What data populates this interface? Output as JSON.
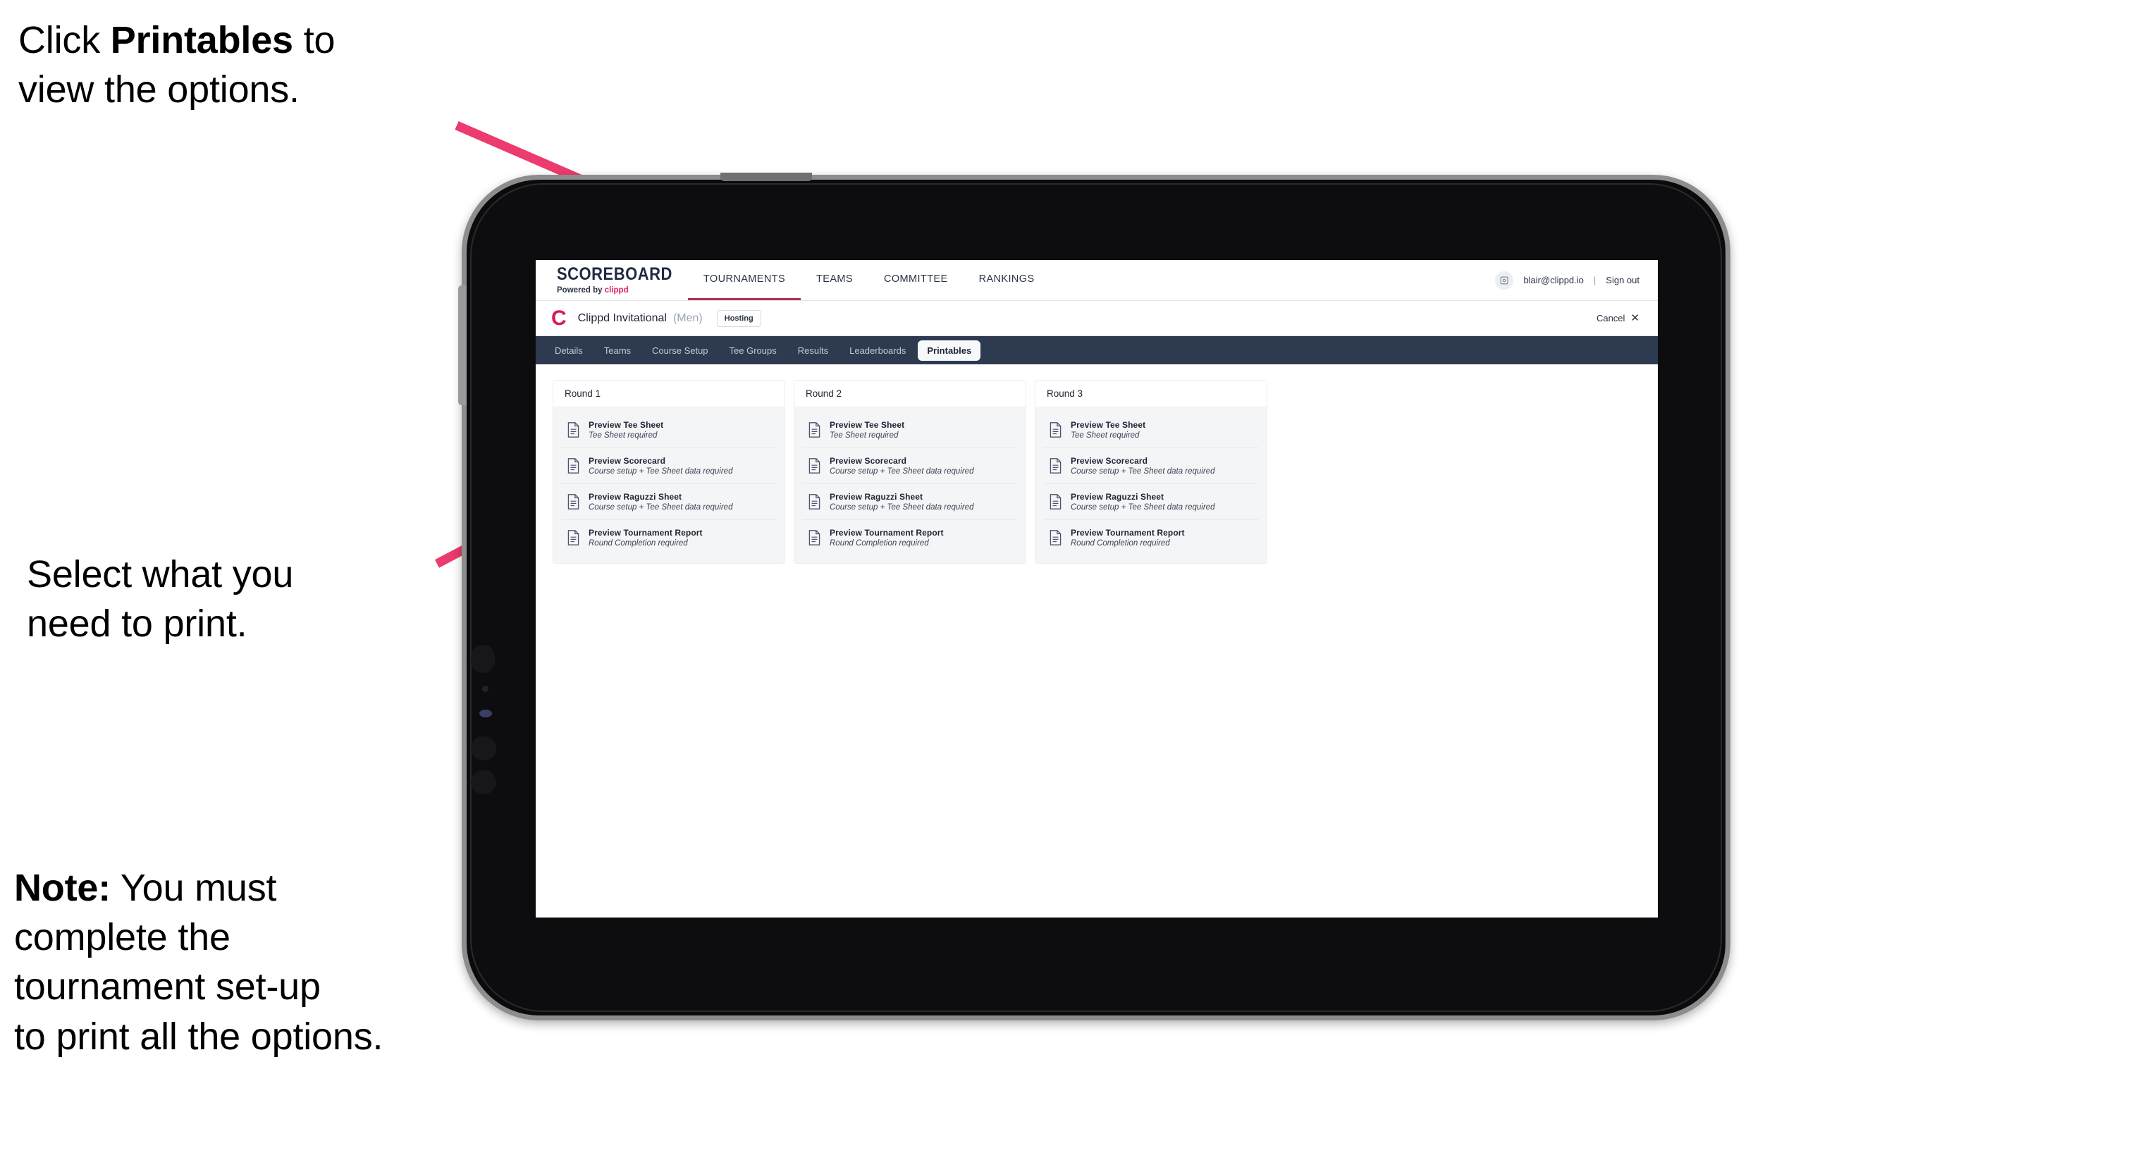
{
  "annotations": {
    "callout_1": {
      "prefix": "Click ",
      "bold": "Printables",
      "suffix": " to\nview the options."
    },
    "callout_2": {
      "text": "Select what you\n need to print."
    },
    "callout_3": {
      "bold": "Note:",
      "text": " You must\ncomplete the\ntournament set-up\nto print all the options."
    },
    "arrow_color": "#ec3b6e"
  },
  "app": {
    "brand": {
      "title": "SCOREBOARD",
      "powered_prefix": "Powered by ",
      "powered_brand": "clippd"
    },
    "main_nav": [
      {
        "label": "TOURNAMENTS",
        "active": true
      },
      {
        "label": "TEAMS",
        "active": false
      },
      {
        "label": "COMMITTEE",
        "active": false
      },
      {
        "label": "RANKINGS",
        "active": false
      }
    ],
    "account": {
      "avatar_glyph": "⛶",
      "email": "blair@clippd.io",
      "divider": "|",
      "sign_out": "Sign out"
    },
    "tournament": {
      "logo_letter": "C",
      "name": "Clippd Invitational",
      "gender": "(Men)",
      "status_badge": "Hosting",
      "cancel_label": "Cancel",
      "cancel_icon": "✕"
    },
    "tabs": [
      {
        "label": "Details",
        "active": false
      },
      {
        "label": "Teams",
        "active": false
      },
      {
        "label": "Course Setup",
        "active": false
      },
      {
        "label": "Tee Groups",
        "active": false
      },
      {
        "label": "Results",
        "active": false
      },
      {
        "label": "Leaderboards",
        "active": false
      },
      {
        "label": "Printables",
        "active": true
      }
    ],
    "rounds": [
      {
        "title": "Round 1",
        "items": [
          {
            "title": "Preview Tee Sheet",
            "subtitle": "Tee Sheet required"
          },
          {
            "title": "Preview Scorecard",
            "subtitle": "Course setup + Tee Sheet data required"
          },
          {
            "title": "Preview Raguzzi Sheet",
            "subtitle": "Course setup + Tee Sheet data required"
          },
          {
            "title": "Preview Tournament Report",
            "subtitle": "Round Completion required"
          }
        ]
      },
      {
        "title": "Round 2",
        "items": [
          {
            "title": "Preview Tee Sheet",
            "subtitle": "Tee Sheet required"
          },
          {
            "title": "Preview Scorecard",
            "subtitle": "Course setup + Tee Sheet data required"
          },
          {
            "title": "Preview Raguzzi Sheet",
            "subtitle": "Course setup + Tee Sheet data required"
          },
          {
            "title": "Preview Tournament Report",
            "subtitle": "Round Completion required"
          }
        ]
      },
      {
        "title": "Round 3",
        "items": [
          {
            "title": "Preview Tee Sheet",
            "subtitle": "Tee Sheet required"
          },
          {
            "title": "Preview Scorecard",
            "subtitle": "Course setup + Tee Sheet data required"
          },
          {
            "title": "Preview Raguzzi Sheet",
            "subtitle": "Course setup + Tee Sheet data required"
          },
          {
            "title": "Preview Tournament Report",
            "subtitle": "Round Completion required"
          }
        ]
      }
    ]
  },
  "colors": {
    "tabbar_bg": "#2d3a50",
    "accent_pink": "#d81b56",
    "arrow_pink": "#ec3b6e",
    "text_dark": "#1d2433"
  }
}
